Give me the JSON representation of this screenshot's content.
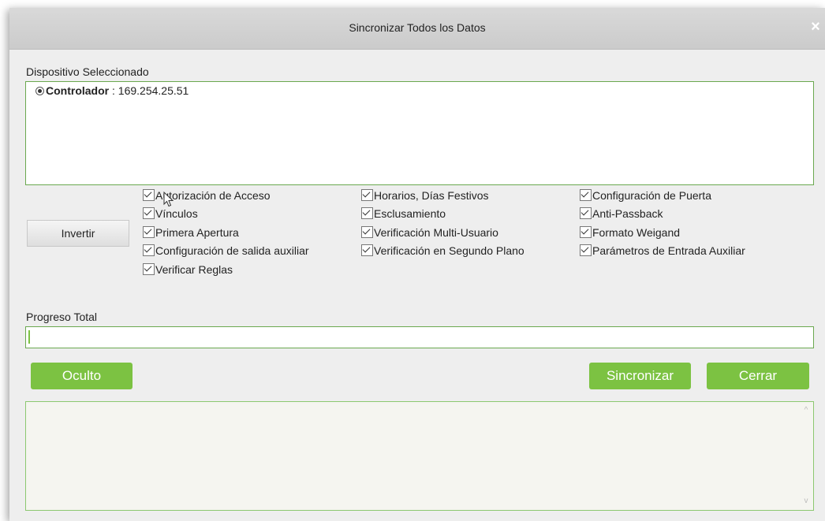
{
  "dialog": {
    "title": "Sincronizar Todos los Datos",
    "close_symbol": "×"
  },
  "device_section": {
    "label": "Dispositivo Seleccionado",
    "device": {
      "name": "Controlador",
      "separator": " : ",
      "ip": "169.254.25.51",
      "selected": true
    }
  },
  "options": {
    "invert_label": "Invertir",
    "columns": [
      [
        {
          "label": "Autorización de Acceso",
          "checked": true
        },
        {
          "label": "Vínculos",
          "checked": true
        },
        {
          "label": "Primera Apertura",
          "checked": true
        },
        {
          "label": "Configuración de salida auxiliar",
          "checked": true
        },
        {
          "label": "Verificar Reglas",
          "checked": true
        }
      ],
      [
        {
          "label": "Horarios, Días Festivos",
          "checked": true
        },
        {
          "label": "Esclusamiento",
          "checked": true
        },
        {
          "label": "Verificación Multi-Usuario",
          "checked": true
        },
        {
          "label": "Verificación en Segundo Plano",
          "checked": true
        }
      ],
      [
        {
          "label": "Configuración de Puerta",
          "checked": true
        },
        {
          "label": "Anti-Passback",
          "checked": true
        },
        {
          "label": "Formato Weigand",
          "checked": true
        },
        {
          "label": "Parámetros de Entrada Auxiliar",
          "checked": true
        }
      ]
    ]
  },
  "progress": {
    "label": "Progreso Total",
    "value_percent": 0
  },
  "buttons": {
    "hidden_label": "Oculto",
    "sync_label": "Sincronizar",
    "close_label": "Cerrar"
  },
  "colors": {
    "accent_green": "#7cc242",
    "border_green": "#6aa84f",
    "titlebar": "#d0d0d0",
    "dialog_bg": "#eeeeee"
  },
  "icons": {
    "close": "close-icon",
    "radio": "radio-selected-icon",
    "checkbox": "checkbox-checked-icon",
    "cursor": "mouse-pointer-icon",
    "scroll_up": "chevron-up-icon",
    "scroll_down": "chevron-down-icon"
  }
}
